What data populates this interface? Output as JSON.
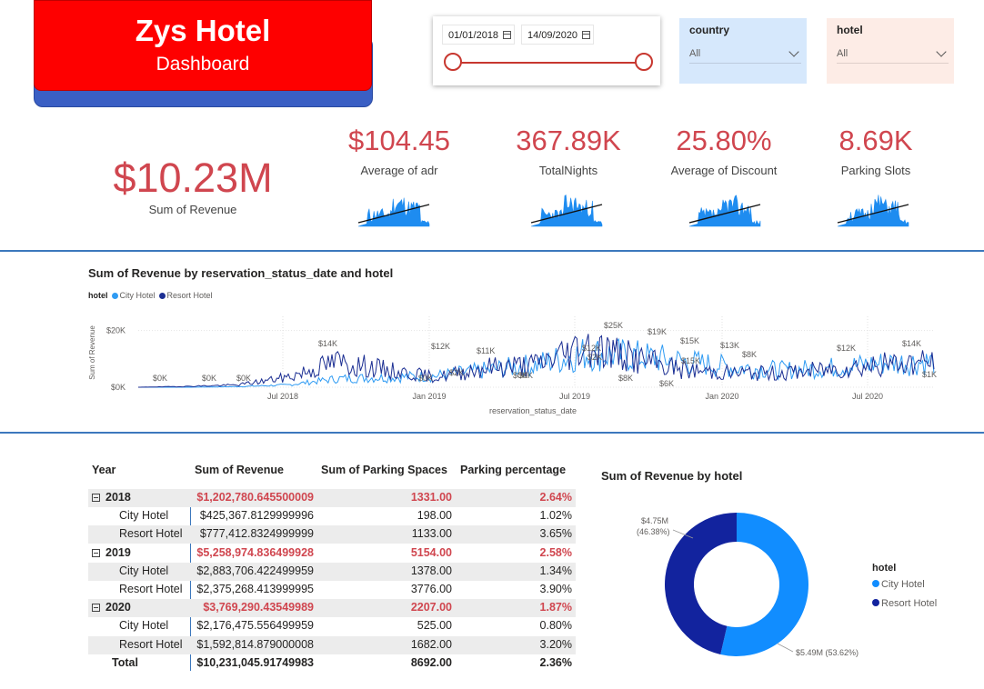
{
  "header": {
    "title": "Zys Hotel",
    "subtitle": "Dashboard"
  },
  "date_slicer": {
    "start": "01/01/2018",
    "end": "14/09/2020"
  },
  "slicers": [
    {
      "title": "country",
      "value": "All",
      "bg": "#d6e8fc"
    },
    {
      "title": "hotel",
      "value": "All",
      "bg": "#fdece6"
    }
  ],
  "kpis": {
    "revenue": {
      "value": "$10.23M",
      "label": "Sum of Revenue"
    },
    "adr": {
      "value": "$104.45",
      "label": "Average of adr"
    },
    "nights": {
      "value": "367.89K",
      "label": "TotalNights"
    },
    "discount": {
      "value": "25.80%",
      "label": "Average of Discount"
    },
    "parking": {
      "value": "8.69K",
      "label": "Parking Slots"
    }
  },
  "line_chart": {
    "title": "Sum of Revenue by reservation_status_date and hotel",
    "legend_title": "hotel",
    "legend": [
      {
        "name": "City Hotel",
        "color": "#2f9bf3"
      },
      {
        "name": "Resort Hotel",
        "color": "#1c2f93"
      }
    ],
    "ylabel": "Sum of Revenue",
    "xlabel": "reservation_status_date",
    "yticks": [
      "$20K",
      "$0K"
    ],
    "xticks": [
      "Jul 2018",
      "Jan 2019",
      "Jul 2019",
      "Jan 2020",
      "Jul 2020"
    ],
    "annotations": [
      "$0K",
      "$0K",
      "$0K",
      "$14K",
      "$12K",
      "$11K",
      "$0K",
      "$2K",
      "$0K",
      "$0K",
      "$12K",
      "$25K",
      "$19K",
      "$15K",
      "$13K",
      "$8K",
      "$6K",
      "$8K",
      "$12K",
      "$14K",
      "$1K",
      "$15K",
      "$2K"
    ]
  },
  "chart_data": [
    {
      "type": "line",
      "title": "Sum of Revenue by reservation_status_date and hotel",
      "xlabel": "reservation_status_date",
      "ylabel": "Sum of Revenue",
      "ylim": [
        0,
        25000
      ],
      "x": [
        "2018-01",
        "2018-03",
        "2018-05",
        "2018-07",
        "2018-09",
        "2018-11",
        "2019-01",
        "2019-03",
        "2019-05",
        "2019-07",
        "2019-09",
        "2019-11",
        "2020-01",
        "2020-03",
        "2020-05",
        "2020-07",
        "2020-09"
      ],
      "series": [
        {
          "name": "City Hotel",
          "values": [
            0,
            0,
            200,
            800,
            3000,
            3500,
            4000,
            6000,
            8000,
            12000,
            11000,
            9000,
            7000,
            6000,
            7000,
            8500,
            9000
          ]
        },
        {
          "name": "Resort Hotel",
          "values": [
            0,
            300,
            800,
            3500,
            9000,
            6000,
            3500,
            7000,
            8000,
            15000,
            10000,
            6000,
            5000,
            5000,
            6500,
            8000,
            9000
          ]
        }
      ]
    },
    {
      "type": "pie",
      "title": "Sum of Revenue by hotel",
      "categories": [
        "City Hotel",
        "Resort Hotel"
      ],
      "values": [
        5.49,
        4.75
      ],
      "labels": [
        "$5.49M (53.62%)",
        "$4.75M (46.38%)"
      ],
      "colors": [
        "#118dff",
        "#12239e"
      ]
    }
  ],
  "matrix": {
    "headers": [
      "Year",
      "Sum of Revenue",
      "Sum of Parking Spaces",
      "Parking percentage"
    ],
    "rows": [
      {
        "label": "2018",
        "kind": "year",
        "revenue": "$1,202,780.645500009",
        "parking": "1331.00",
        "pct": "2.64%"
      },
      {
        "label": "City Hotel",
        "kind": "hotel",
        "revenue": "$425,367.8129999996",
        "parking": "198.00",
        "pct": "1.02%"
      },
      {
        "label": "Resort Hotel",
        "kind": "hotel",
        "revenue": "$777,412.8324999999",
        "parking": "1133.00",
        "pct": "3.65%"
      },
      {
        "label": "2019",
        "kind": "year",
        "revenue": "$5,258,974.836499928",
        "parking": "5154.00",
        "pct": "2.58%"
      },
      {
        "label": "City Hotel",
        "kind": "hotel",
        "revenue": "$2,883,706.422499959",
        "parking": "1378.00",
        "pct": "1.34%"
      },
      {
        "label": "Resort Hotel",
        "kind": "hotel",
        "revenue": "$2,375,268.413999995",
        "parking": "3776.00",
        "pct": "3.90%"
      },
      {
        "label": "2020",
        "kind": "year",
        "revenue": "$3,769,290.43549989",
        "parking": "2207.00",
        "pct": "1.87%"
      },
      {
        "label": "City Hotel",
        "kind": "hotel",
        "revenue": "$2,176,475.556499959",
        "parking": "525.00",
        "pct": "0.80%"
      },
      {
        "label": "Resort Hotel",
        "kind": "hotel",
        "revenue": "$1,592,814.879000008",
        "parking": "1682.00",
        "pct": "3.20%"
      },
      {
        "label": "Total",
        "kind": "total",
        "revenue": "$10,231,045.91749983",
        "parking": "8692.00",
        "pct": "2.36%"
      }
    ]
  },
  "pie": {
    "title": "Sum of Revenue by hotel",
    "legend_title": "hotel",
    "legend": [
      "City Hotel",
      "Resort Hotel"
    ],
    "label_resort_value": "$4.75M",
    "label_resort_pct": "(46.38%)",
    "label_city": "$5.49M (53.62%)"
  }
}
